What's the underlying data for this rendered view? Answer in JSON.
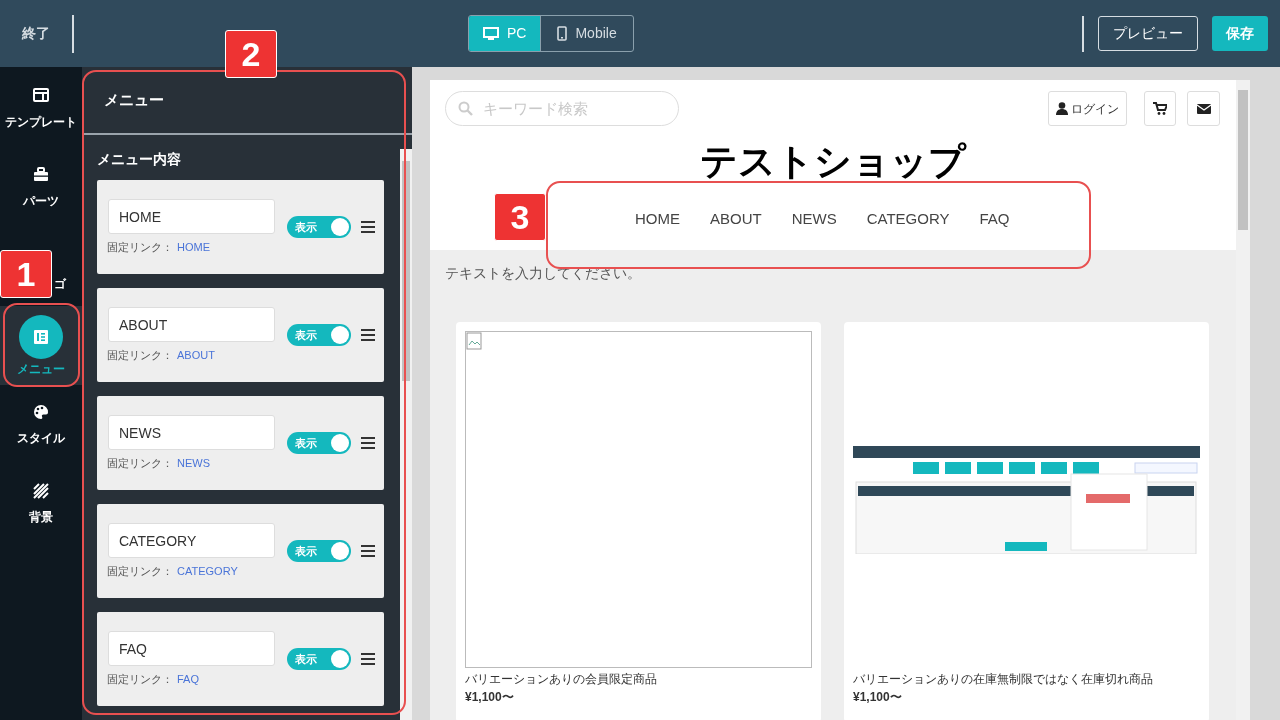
{
  "topbar": {
    "exit": "終了",
    "device_tabs": [
      {
        "label": "PC",
        "kind": "monitor",
        "selected": true
      },
      {
        "label": "Mobile",
        "kind": "phone",
        "selected": false
      }
    ],
    "preview": "プレビュー",
    "save": "保存"
  },
  "rail": [
    {
      "label": "テンプレート",
      "kind": "template",
      "selected": false
    },
    {
      "label": "パーツ",
      "kind": "parts",
      "selected": false
    },
    {
      "label": "ゴ",
      "kind": "logo",
      "selected": false
    },
    {
      "label": "メニュー",
      "kind": "menu",
      "selected": true
    },
    {
      "label": "スタイル",
      "kind": "style",
      "selected": false
    },
    {
      "label": "背景",
      "kind": "background",
      "selected": false
    }
  ],
  "panel": {
    "title": "メニュー",
    "section": "メニュー内容",
    "items": [
      {
        "name": "HOME",
        "toggle": "表示",
        "on": true,
        "link_label": "固定リンク：",
        "link": "HOME"
      },
      {
        "name": "ABOUT",
        "toggle": "表示",
        "on": true,
        "link_label": "固定リンク：",
        "link": "ABOUT"
      },
      {
        "name": "NEWS",
        "toggle": "表示",
        "on": true,
        "link_label": "固定リンク：",
        "link": "NEWS"
      },
      {
        "name": "CATEGORY",
        "toggle": "表示",
        "on": true,
        "link_label": "固定リンク：",
        "link": "CATEGORY"
      },
      {
        "name": "FAQ",
        "toggle": "表示",
        "on": true,
        "link_label": "固定リンク：",
        "link": "FAQ"
      }
    ]
  },
  "preview": {
    "search_placeholder": "キーワード検索",
    "login": "ログイン",
    "shop_title": "テストショップ",
    "nav": [
      "HOME",
      "ABOUT",
      "NEWS",
      "CATEGORY",
      "FAQ"
    ],
    "notice": "テキストを入力してください。",
    "products": [
      {
        "name": "バリエーションありの会員限定商品",
        "price": "¥1,100〜",
        "kind": "broken"
      },
      {
        "name": "バリエーションありの在庫無制限ではなく在庫切れ商品",
        "price": "¥1,100〜",
        "kind": "picture"
      }
    ]
  },
  "annotations": [
    "1",
    "2",
    "3"
  ]
}
